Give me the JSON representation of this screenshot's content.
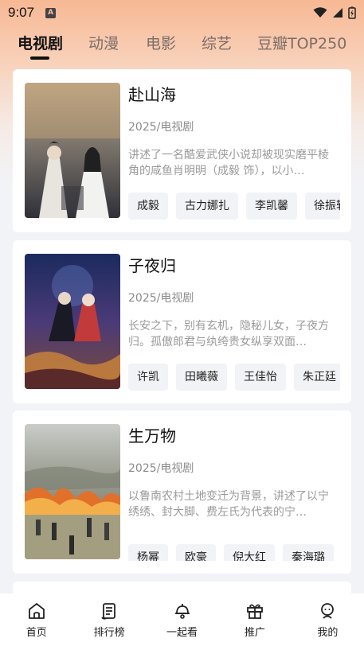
{
  "status": {
    "time": "9:07",
    "badge": "A"
  },
  "tabs": [
    {
      "label": "电视剧",
      "active": true
    },
    {
      "label": "动漫"
    },
    {
      "label": "电影"
    },
    {
      "label": "综艺"
    },
    {
      "label": "豆瓣TOP250"
    }
  ],
  "items": [
    {
      "title": "赴山海",
      "meta": "2025/电视剧",
      "desc": "讲述了一名酷爱武侠小说却被现实磨平棱角的咸鱼肖明明（成毅 饰），以小…",
      "tags": [
        "成毅",
        "古力娜扎",
        "李凯馨",
        "徐振轩"
      ]
    },
    {
      "title": "子夜归",
      "meta": "2025/电视剧",
      "desc": "长安之下，别有玄机，隐秘儿女，子夜方归。孤傲郎君与纨绔贵女纵享双面…",
      "tags": [
        "许凯",
        "田曦薇",
        "王佳怡",
        "朱正廷"
      ]
    },
    {
      "title": "生万物",
      "meta": "2025/电视剧",
      "desc": "以鲁南农村土地变迁为背景，讲述了以宁绣绣、封大脚、费左氏为代表的宁…",
      "tags": [
        "杨幂",
        "欧豪",
        "倪大红",
        "秦海璐",
        ""
      ]
    }
  ],
  "nav": [
    {
      "label": "首页",
      "icon": "home-icon"
    },
    {
      "label": "排行榜",
      "icon": "ranking-icon"
    },
    {
      "label": "一起看",
      "icon": "watch-together-icon"
    },
    {
      "label": "推广",
      "icon": "gift-icon"
    },
    {
      "label": "我的",
      "icon": "profile-icon"
    }
  ],
  "colors": {
    "accent": "#f7b894",
    "text": "#111111",
    "muted": "#9a9a9a",
    "tag_bg": "#f1f3f6"
  }
}
